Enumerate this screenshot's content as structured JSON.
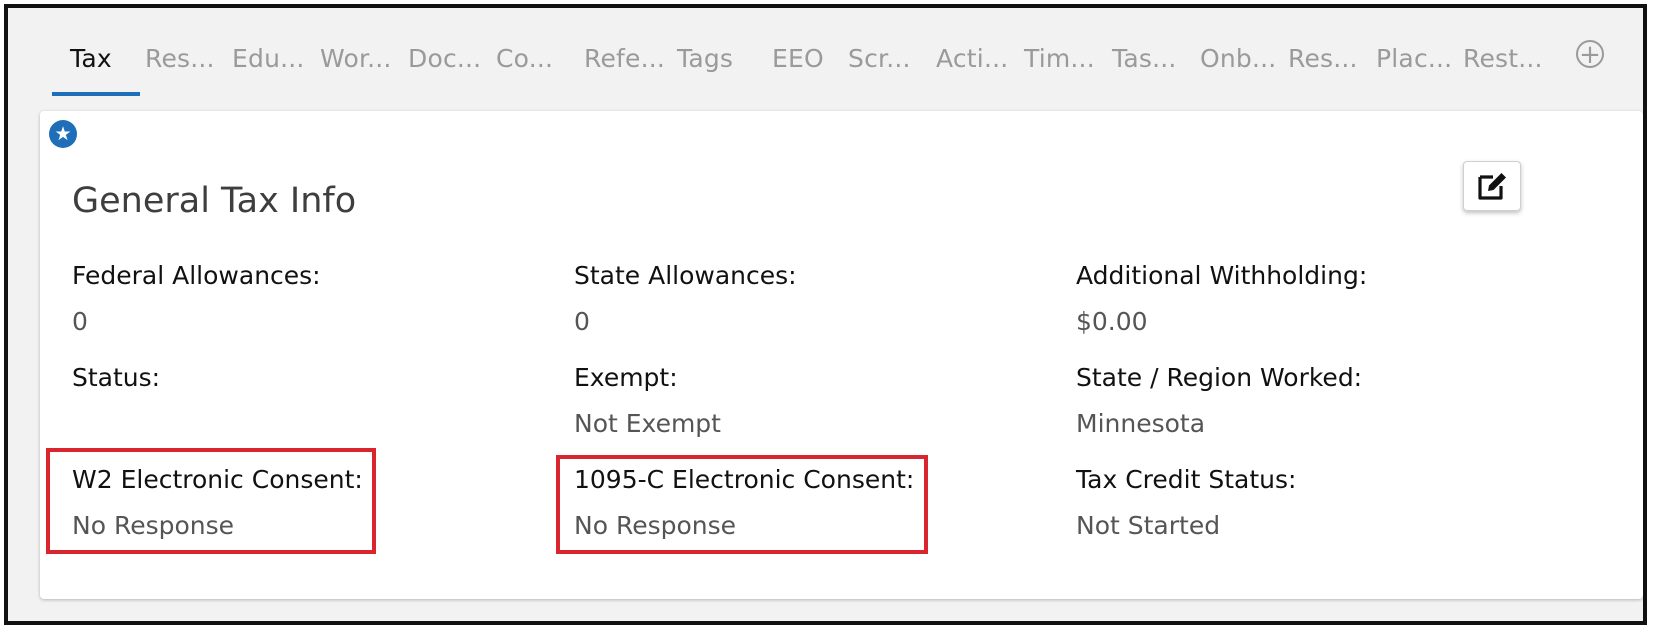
{
  "tabs": [
    {
      "label": "Tax",
      "active": true
    },
    {
      "label": "Res..."
    },
    {
      "label": "Edu..."
    },
    {
      "label": "Wor..."
    },
    {
      "label": "Doc..."
    },
    {
      "label": "Co..."
    },
    {
      "label": "Refe..."
    },
    {
      "label": "Tags"
    },
    {
      "label": "EEO"
    },
    {
      "label": "Scr..."
    },
    {
      "label": "Acti..."
    },
    {
      "label": "Tim..."
    },
    {
      "label": "Tas..."
    },
    {
      "label": "Onb..."
    },
    {
      "label": "Res..."
    },
    {
      "label": "Plac..."
    },
    {
      "label": "Rest..."
    }
  ],
  "add_tab_symbol": "+",
  "card": {
    "title": "General Tax Info",
    "star_icon": "★",
    "fields": {
      "federal_allowances": {
        "label": "Federal Allowances:",
        "value": "0"
      },
      "state_allowances": {
        "label": "State Allowances:",
        "value": "0"
      },
      "additional_withholding": {
        "label": "Additional Withholding:",
        "value": "$0.00"
      },
      "status": {
        "label": "Status:",
        "value": ""
      },
      "exempt": {
        "label": "Exempt:",
        "value": "Not Exempt"
      },
      "state_region_worked": {
        "label": "State / Region Worked:",
        "value": "Minnesota"
      },
      "w2_consent": {
        "label": "W2 Electronic Consent:",
        "value": "No Response"
      },
      "c1095_consent": {
        "label": "1095-C Electronic Consent:",
        "value": "No Response"
      },
      "tax_credit_status": {
        "label": "Tax Credit Status:",
        "value": "Not Started"
      }
    }
  },
  "colors": {
    "accent": "#1f6fb8",
    "highlight": "#d9262e"
  }
}
